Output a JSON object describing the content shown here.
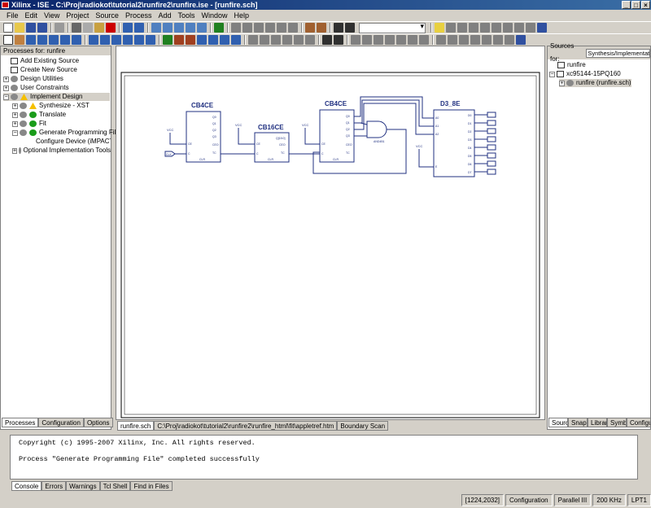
{
  "window": {
    "title": "Xilinx - ISE - C:\\Proj\\radiokot\\tutorial2\\runfire2\\runfire.ise - [runfire.sch]",
    "buttons": [
      "_",
      "□",
      "×"
    ]
  },
  "menu": [
    "File",
    "Edit",
    "View",
    "Project",
    "Source",
    "Process",
    "Add",
    "Tools",
    "Window",
    "Help"
  ],
  "processes": {
    "header": "Processes for: runfire",
    "items": [
      "Add Existing Source",
      "Create New Source",
      "Design Utilities",
      "User Constraints",
      "Implement Design",
      "Synthesize - XST",
      "Translate",
      "Fit",
      "Generate Programming File",
      "Configure Device (iMPACT)",
      "Optional Implementation Tools"
    ],
    "tabs": [
      "Processes",
      "Configuration",
      "Options"
    ]
  },
  "sources": {
    "header": "Sources for:",
    "selected": "Synthesis/Implementation",
    "items": [
      "runfire",
      "xc95144-15PQ160",
      "runfire (runfire.sch)"
    ],
    "tabs": [
      "Sources",
      "Snapshots",
      "Libraries",
      "Symbols",
      "Configuration"
    ]
  },
  "schematic": {
    "blocks": [
      "CB4CE",
      "CB16CE",
      "CB4CE",
      "D3_8E"
    ],
    "gate_label": "AND4B1",
    "vcc": "VCC",
    "pins_cb4": [
      "Q0",
      "Q1",
      "Q2",
      "Q3",
      "CEO",
      "TC",
      "CE",
      "C",
      "CLR"
    ],
    "pins_cb16": [
      "Q[15:0]",
      "CEO",
      "TC",
      "CE",
      "C",
      "CLR"
    ],
    "pins_dec_in": [
      "A0",
      "A1",
      "A2",
      "E"
    ],
    "pins_dec_out": [
      "D0",
      "D1",
      "D2",
      "D3",
      "D4",
      "D5",
      "D6",
      "D7"
    ],
    "clk_label": "CLK"
  },
  "doc_tabs": [
    "runfire.sch",
    "C:\\Proj\\radiokot\\tutorial2\\runfire2\\runfire_html\\fit\\appletref.htm",
    "Boundary Scan"
  ],
  "console": {
    "lines": [
      "Copyright (c) 1995-2007 Xilinx, Inc.  All rights reserved.",
      "",
      "Process \"Generate Programming File\" completed successfully"
    ],
    "tabs": [
      "Console",
      "Errors",
      "Warnings",
      "Tcl Shell",
      "Find in Files"
    ]
  },
  "status": [
    "[1224,2032]",
    "Configuration",
    "Parallel III",
    "200 KHz",
    "LPT1"
  ]
}
